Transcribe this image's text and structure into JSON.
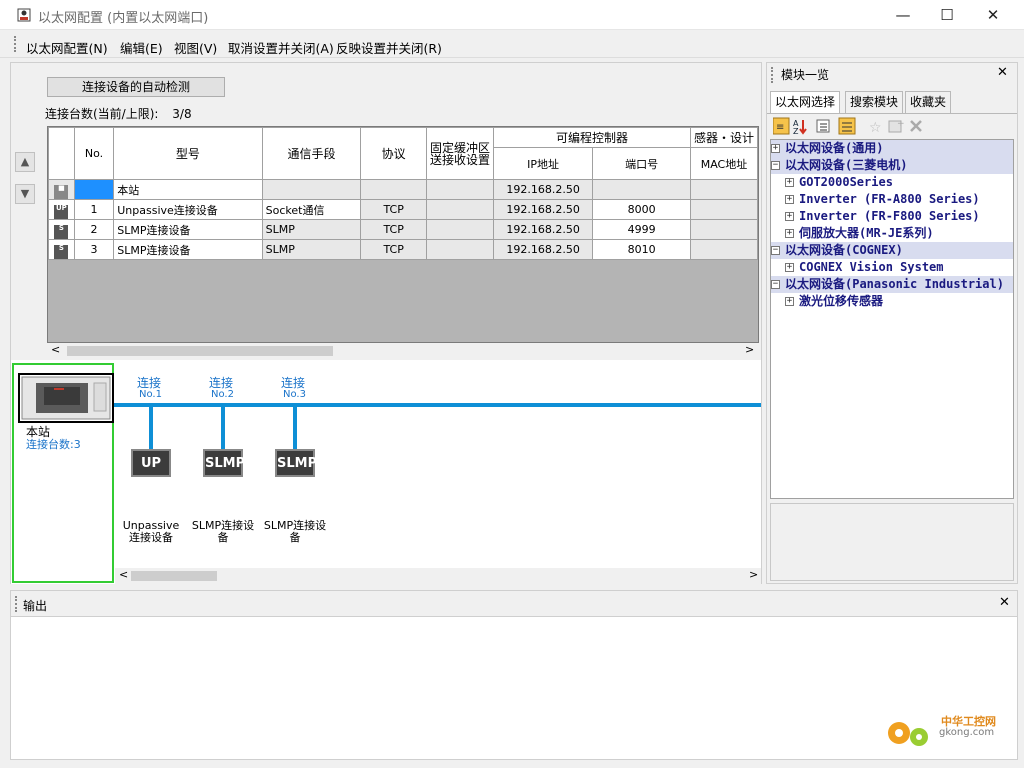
{
  "window": {
    "title": "以太网配置 (内置以太网端口)",
    "min_symbol": "—",
    "max_symbol": "☐",
    "close_symbol": "✕"
  },
  "menu": [
    {
      "label": "以太网配置(N)"
    },
    {
      "label": "编辑(E)"
    },
    {
      "label": "视图(V)"
    },
    {
      "label": "取消设置并关闭(A)"
    },
    {
      "label": "反映设置并关闭(R)"
    }
  ],
  "left": {
    "autodetect_label": "连接设备的自动检测",
    "conn_count_label": "连接台数(当前/上限):",
    "conn_count_value": "3/8",
    "up_arrow": "▲",
    "down_arrow": "▼"
  },
  "table": {
    "headers": {
      "no": "No.",
      "model": "型号",
      "comm": "通信手段",
      "protocol": "协议",
      "fixed": "固定缓冲区",
      "fixed2": "送接收设置",
      "plc": "可编程控制器",
      "ip": "IP地址",
      "port": "端口号",
      "sensor": "感器・设计",
      "mac": "MAC地址"
    },
    "rows": [
      {
        "icon": "■",
        "no": "",
        "model": "本站",
        "comm": "",
        "protocol": "",
        "fixed": "",
        "ip": "192.168.2.50",
        "port": "",
        "mac": ""
      },
      {
        "icon": "UP",
        "no": "1",
        "model": "Unpassive连接设备",
        "comm": "Socket通信",
        "protocol": "TCP",
        "fixed": "",
        "ip": "192.168.2.50",
        "port": "8000",
        "mac": ""
      },
      {
        "icon": "S",
        "no": "2",
        "model": "SLMP连接设备",
        "comm": "SLMP",
        "protocol": "TCP",
        "fixed": "",
        "ip": "192.168.2.50",
        "port": "4999",
        "mac": ""
      },
      {
        "icon": "S",
        "no": "3",
        "model": "SLMP连接设备",
        "comm": "SLMP",
        "protocol": "TCP",
        "fixed": "",
        "ip": "192.168.2.50",
        "port": "8010",
        "mac": ""
      }
    ]
  },
  "diagram": {
    "station_label": "本站",
    "station_count": "连接台数:3",
    "connections": [
      {
        "label": "连接",
        "no": "No.1",
        "icon": "UP",
        "device": "Unpassive",
        "device2": "连接设备"
      },
      {
        "label": "连接",
        "no": "No.2",
        "icon": "SLMP",
        "device": "SLMP连接设",
        "device2": "备"
      },
      {
        "label": "连接",
        "no": "No.3",
        "icon": "SLMP",
        "device": "SLMP连接设",
        "device2": "备"
      }
    ],
    "scroll_left": "<",
    "scroll_right": ">"
  },
  "module_panel": {
    "title": "模块一览",
    "close_symbol": "✕",
    "tabs": [
      "以太网选择",
      "搜索模块",
      "收藏夹"
    ],
    "tree": [
      {
        "level": 0,
        "expander": "⊞",
        "label": "以太网设备(通用)"
      },
      {
        "level": 0,
        "expander": "⊟",
        "label": "以太网设备(三菱电机)"
      },
      {
        "level": 1,
        "expander": "⊞",
        "label": "GOT2000Series"
      },
      {
        "level": 1,
        "expander": "⊞",
        "label": "Inverter (FR-A800 Series)"
      },
      {
        "level": 1,
        "expander": "⊞",
        "label": "Inverter (FR-F800 Series)"
      },
      {
        "level": 1,
        "expander": "⊞",
        "label": "伺服放大器(MR-JE系列)"
      },
      {
        "level": 0,
        "expander": "⊟",
        "label": "以太网设备(COGNEX)"
      },
      {
        "level": 1,
        "expander": "⊞",
        "label": "COGNEX Vision System"
      },
      {
        "level": 0,
        "expander": "⊟",
        "label": "以太网设备(Panasonic Industrial)"
      },
      {
        "level": 1,
        "expander": "⊞",
        "label": "激光位移传感器"
      }
    ]
  },
  "output": {
    "title": "输出",
    "close_symbol": "✕"
  },
  "watermark": {
    "cn": "中华工控网",
    "en": "gkong.com"
  },
  "colors": {
    "selection": "#1e90ff",
    "bus": "#0e8fd6",
    "station_border": "#33cc33",
    "tree_text": "#1a1a80"
  }
}
